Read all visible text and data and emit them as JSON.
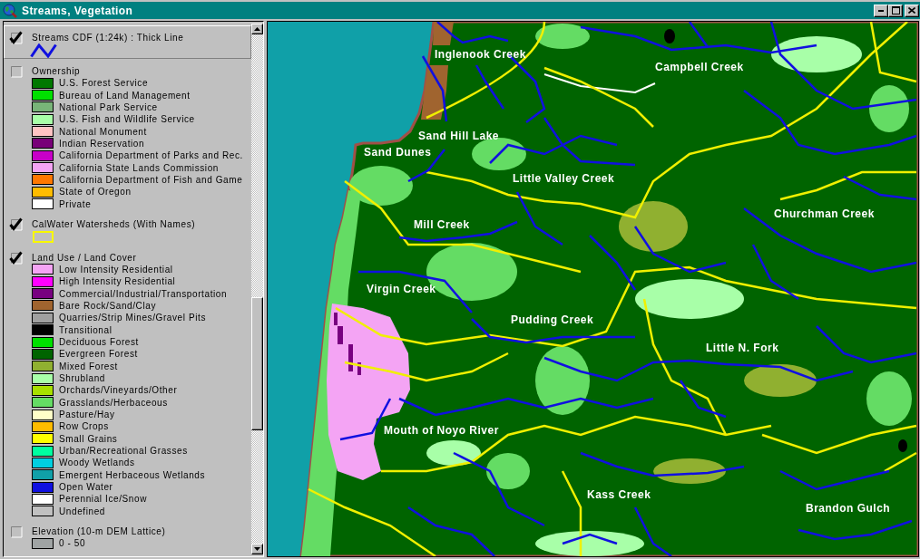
{
  "window": {
    "title": "Streams, Vegetation"
  },
  "legend": {
    "layers": [
      {
        "kind": "line",
        "title": "Streams CDF (1:24k) : Thick Line",
        "checked": true,
        "selected": true,
        "color": "#1010e0"
      },
      {
        "kind": "classes",
        "title": "Ownership",
        "checked": false,
        "selected": false,
        "classes": [
          {
            "label": "U.S. Forest Service",
            "color": "#007800"
          },
          {
            "label": "Bureau of Land Management",
            "color": "#00e000"
          },
          {
            "label": "National Park Service",
            "color": "#78b478"
          },
          {
            "label": "U.S. Fish and Wildlife Service",
            "color": "#a8ffa8"
          },
          {
            "label": "National Monument",
            "color": "#ffc4c4"
          },
          {
            "label": "Indian Reservation",
            "color": "#780078"
          },
          {
            "label": "California Department of Parks and Rec.",
            "color": "#c800c8"
          },
          {
            "label": "California State Lands Commission",
            "color": "#f4a4f4"
          },
          {
            "label": "California Department of Fish and Game",
            "color": "#ff7800"
          },
          {
            "label": "State of Oregon",
            "color": "#ffbc00"
          },
          {
            "label": "Private",
            "color": "#ffffff"
          }
        ]
      },
      {
        "kind": "outline",
        "title": "CalWater Watersheds (With Names)",
        "checked": true,
        "selected": false,
        "color": "#f8f800"
      },
      {
        "kind": "classes",
        "title": "Land Use / Land Cover",
        "checked": true,
        "selected": false,
        "classes": [
          {
            "label": "Low Intensity Residential",
            "color": "#f4a4f4"
          },
          {
            "label": "High Intensity Residential",
            "color": "#ff00ff"
          },
          {
            "label": "Commercial/Industrial/Transportation",
            "color": "#780080"
          },
          {
            "label": "Bare Rock/Sand/Clay",
            "color": "#a0642f"
          },
          {
            "label": "Quarries/Strip Mines/Gravel Pits",
            "color": "#a0a0a0"
          },
          {
            "label": "Transitional",
            "color": "#000000"
          },
          {
            "label": "Deciduous Forest",
            "color": "#00e000"
          },
          {
            "label": "Evergreen Forest",
            "color": "#006400"
          },
          {
            "label": "Mixed Forest",
            "color": "#90b030"
          },
          {
            "label": "Shrubland",
            "color": "#a8ffa8"
          },
          {
            "label": "Orchards/Vineyards/Other",
            "color": "#a8e000"
          },
          {
            "label": "Grasslands/Herbaceous",
            "color": "#64dc64"
          },
          {
            "label": "Pasture/Hay",
            "color": "#ffffc8"
          },
          {
            "label": "Row Crops",
            "color": "#ffbc00"
          },
          {
            "label": "Small Grains",
            "color": "#ffff00"
          },
          {
            "label": "Urban/Recreational Grasses",
            "color": "#00ffa0"
          },
          {
            "label": "Woody Wetlands",
            "color": "#00d0e0"
          },
          {
            "label": "Emergent Herbaceous Wetlands",
            "color": "#10a0a8"
          },
          {
            "label": "Open Water",
            "color": "#1010e0"
          },
          {
            "label": "Perennial Ice/Snow",
            "color": "#ffffff"
          },
          {
            "label": "Undefined",
            "color": "#c0c0c0"
          }
        ]
      },
      {
        "kind": "classes",
        "title": "Elevation (10-m DEM Lattice)",
        "checked": false,
        "selected": false,
        "classes": [
          {
            "label": "0 - 50",
            "color": "#a0a4a4"
          }
        ]
      }
    ]
  },
  "map": {
    "labels": [
      "Inglenook Creek",
      "Campbell Creek",
      "Sand Hill Lake",
      "Sand Dunes",
      "Little Valley Creek",
      "Mill Creek",
      "Churchman Creek",
      "Virgin Creek",
      "Pudding Creek",
      "Little N. Fork",
      "Mouth of Noyo River",
      "Kass Creek",
      "Brandon Gulch"
    ]
  }
}
